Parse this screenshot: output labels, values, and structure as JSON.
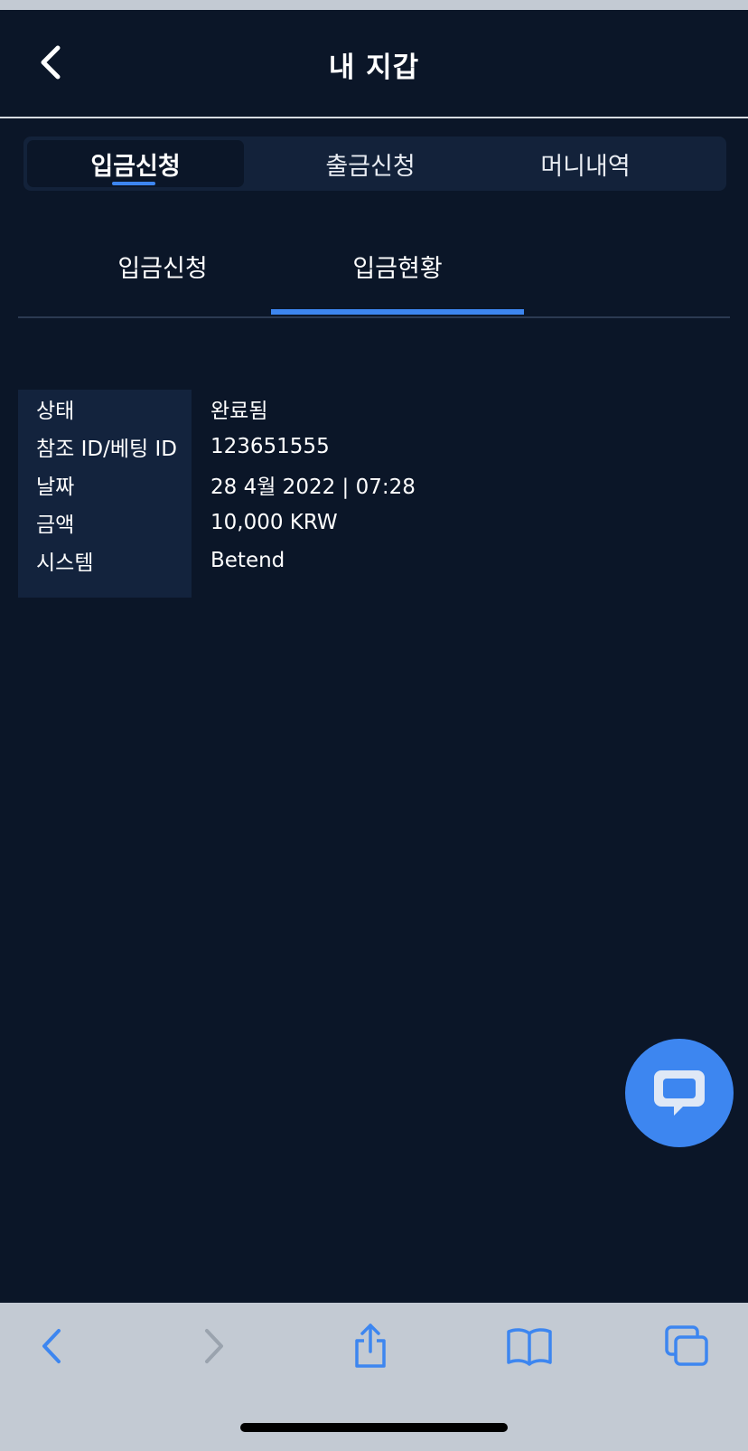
{
  "header": {
    "title": "내 지갑"
  },
  "main_tabs": [
    {
      "label": "입금신청",
      "active": true
    },
    {
      "label": "출금신청",
      "active": false
    },
    {
      "label": "머니내역",
      "active": false
    }
  ],
  "sub_tabs": [
    {
      "label": "입금신청",
      "active": false
    },
    {
      "label": "입금현황",
      "active": true
    }
  ],
  "details": [
    {
      "key": "상태",
      "value": "완료됨"
    },
    {
      "key": "참조 ID/베팅 ID",
      "value": "123651555"
    },
    {
      "key": "날짜",
      "value": "28 4월 2022 | 07:28"
    },
    {
      "key": "금액",
      "value": "10,000 KRW"
    },
    {
      "key": "시스템",
      "value": "Betend"
    }
  ],
  "icons": {
    "back": "chevron-left-icon",
    "chat": "chat-bubble-icon",
    "browser_back": "chevron-left-icon",
    "browser_forward": "chevron-right-icon",
    "share": "share-icon",
    "bookmarks": "book-icon",
    "tabs": "tabs-icon"
  },
  "colors": {
    "background": "#0b1628",
    "accent": "#3d86f0",
    "panel": "#13223a",
    "browser_bar": "#c3cad3"
  }
}
